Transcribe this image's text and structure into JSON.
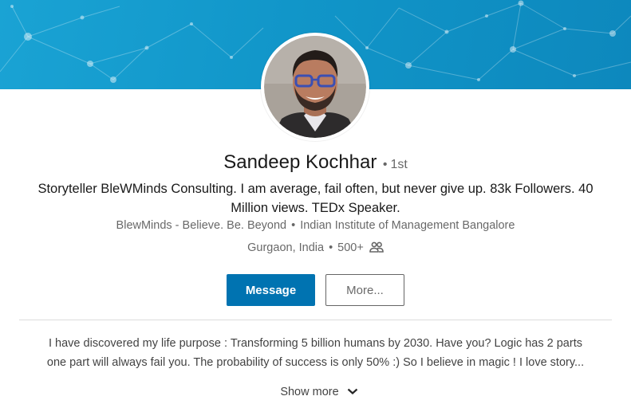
{
  "colors": {
    "banner": "#1196c9",
    "primary_button": "#0073b1",
    "text_primary": "rgba(0,0,0,0.9)",
    "text_secondary": "rgba(0,0,0,0.6)"
  },
  "profile": {
    "name": "Sandeep Kochhar",
    "degree": "1st",
    "headline": "Storyteller BleWMinds Consulting. I am average, fail often, but never give up. 83k Followers. 40 Million views. TEDx Speaker.",
    "company": "BlewMinds - Believe. Be. Beyond",
    "school": "Indian Institute of Management Bangalore",
    "location": "Gurgaon, India",
    "connections": "500+",
    "connections_icon": "people-icon",
    "avatar_icon": "profile-photo"
  },
  "actions": {
    "message_label": "Message",
    "more_label": "More..."
  },
  "about": {
    "line1": "I have discovered my life purpose : Transforming 5 billion humans by 2030. Have you? Logic has 2 parts",
    "line2": "one part will always fail you. The probability of success is only 50% :) So I believe in magic ! I love story...",
    "show_more_label": "Show more",
    "show_more_icon": "chevron-down-icon"
  }
}
